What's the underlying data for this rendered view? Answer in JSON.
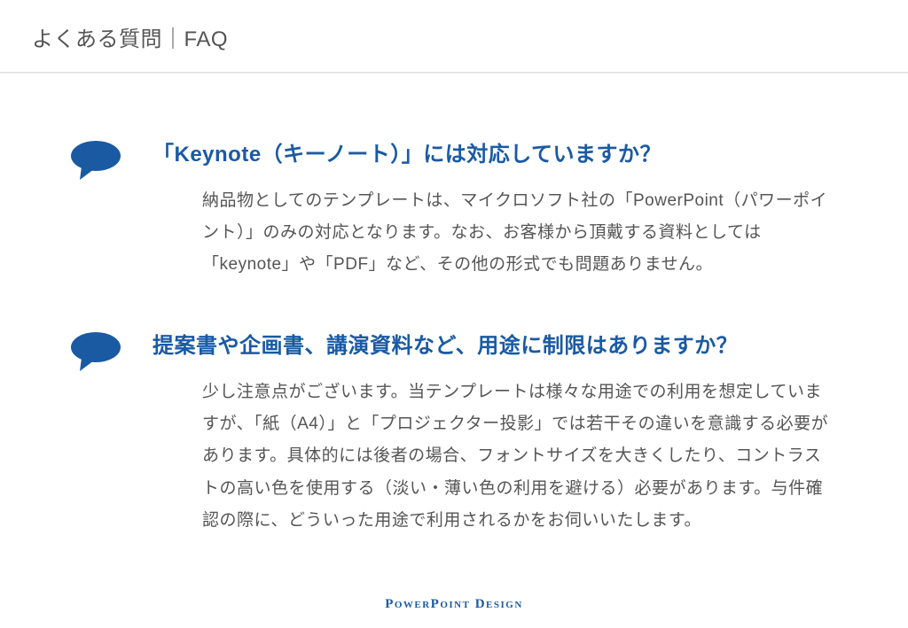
{
  "header": {
    "title": "よくある質問｜FAQ"
  },
  "faqs": [
    {
      "question": "「Keynote（キーノート）」には対応していますか？",
      "answer": "納品物としてのテンプレートは、マイクロソフト社の「PowerPoint（パワーポイント）」のみの対応となります。なお、お客様から頂戴する資料としては「keynote」や「PDF」など、その他の形式でも問題ありません。"
    },
    {
      "question": "提案書や企画書、講演資料など、用途に制限はありますか？",
      "answer": "少し注意点がございます。当テンプレートは様々な用途での利用を想定していますが、「紙（A4）」と「プロジェクター投影」では若干その違いを意識する必要があります。具体的には後者の場合、フォントサイズを大きくしたり、コントラストの高い色を使用する（淡い・薄い色の利用を避ける）必要があります。与件確認の際に、どういった用途で利用されるかをお伺いいたします。"
    }
  ],
  "footer": {
    "brand": "PowerPoint Design"
  },
  "colors": {
    "accent": "#1a5aa3"
  }
}
